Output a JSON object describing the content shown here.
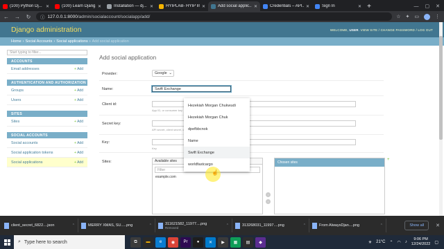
{
  "browser": {
    "tabs": [
      {
        "label": "(100) Python Dj...",
        "favicon_color": "#ff0000",
        "active": false
      },
      {
        "label": "(100) Learn Djang...",
        "favicon_color": "#ff0000",
        "active": false
      },
      {
        "label": "Installation — dj...",
        "favicon_color": "#9aa0a6",
        "active": false
      },
      {
        "label": "HYIPLAB- HYIP In...",
        "favicon_color": "#f5b400",
        "active": false
      },
      {
        "label": "Add social applic...",
        "favicon_color": "#417690",
        "active": true
      },
      {
        "label": "Credentials – API...",
        "favicon_color": "#4285f4",
        "active": false
      },
      {
        "label": "Sign In",
        "favicon_color": "#4285f4",
        "active": false
      }
    ],
    "new_tab": "+",
    "url_host": "127.0.0.1:8000",
    "url_path": "/admin/socialaccount/socialapp/add/"
  },
  "django": {
    "brand": "Django administration",
    "welcome": "WELCOME,",
    "username": "USER",
    "user_links": "VIEW SITE / CHANGE PASSWORD / LOG OUT",
    "breadcrumbs": {
      "home": "Home",
      "app": "Social Accounts",
      "model": "Social applications",
      "current": "Add social application"
    },
    "sidebar_filter_placeholder": "Start typing to filter...",
    "modules": [
      {
        "caption": "ACCOUNTS",
        "rows": [
          {
            "label": "Email addresses",
            "current": false
          }
        ]
      },
      {
        "caption": "AUTHENTICATION AND AUTHORIZATION",
        "rows": [
          {
            "label": "Groups",
            "current": false
          },
          {
            "label": "Users",
            "current": false
          }
        ]
      },
      {
        "caption": "SITES",
        "rows": [
          {
            "label": "Sites",
            "current": false
          }
        ]
      },
      {
        "caption": "SOCIAL ACCOUNTS",
        "rows": [
          {
            "label": "Social accounts",
            "current": false
          },
          {
            "label": "Social application tokens",
            "current": false
          },
          {
            "label": "Social applications",
            "current": true
          }
        ]
      }
    ],
    "add_label": "Add",
    "page_title": "Add social application",
    "form": {
      "provider_label": "Provider:",
      "provider_value": "Google",
      "name_label": "Name:",
      "name_value": "Swift Exchange",
      "client_id_label": "Client id:",
      "client_id_help": "App ID, or consumer key",
      "secret_label": "Secret key:",
      "secret_help": "API secret, client secret, or consumer secret",
      "key_label": "Key:",
      "key_help": "Key",
      "sites_label": "Sites:",
      "available_caption": "Available sites",
      "filter_placeholder": "Filter",
      "available_options": [
        "example.com"
      ],
      "chosen_caption": "Chosen sites"
    },
    "autocomplete": [
      "Hezekiah Morgan Chukwudi",
      "Hezekiah Morgan Chuk",
      "dpefbbcnok",
      "Name",
      "Swift Exchange",
      "worldfastcargo"
    ]
  },
  "downloads": {
    "items": [
      {
        "name": "client_secret_6822....json",
        "sub": ""
      },
      {
        "name": "MERRY XMAS, SU.....png",
        "sub": ""
      },
      {
        "name": "311621582_11977....png",
        "sub": "Removed"
      },
      {
        "name": "313268031_11997....png",
        "sub": ""
      },
      {
        "name": "From AlwaysDjan....png",
        "sub": ""
      }
    ],
    "show_all": "Show all"
  },
  "taskbar": {
    "search_placeholder": "Type here to search",
    "weather": "21°C",
    "time": "9:06 PM",
    "date": "12/24/2022"
  }
}
